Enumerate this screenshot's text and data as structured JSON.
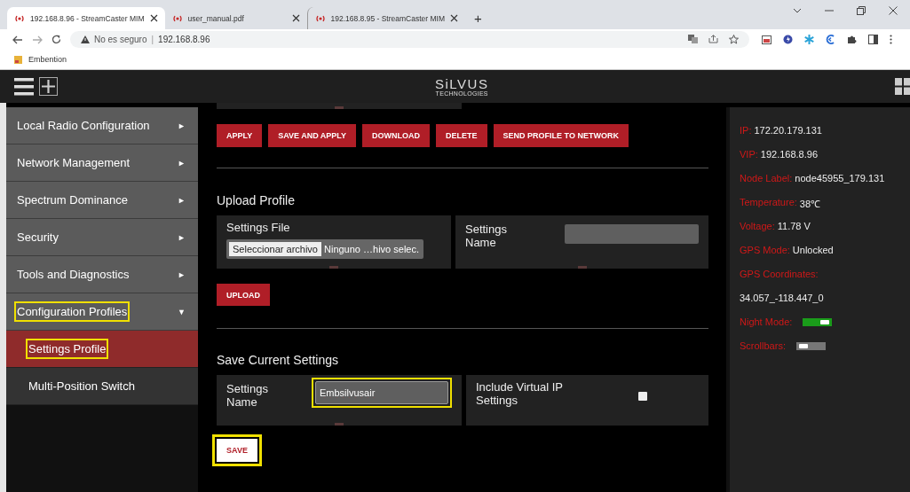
{
  "browser": {
    "tabs": [
      {
        "title": "192.168.8.96 - StreamCaster MIM",
        "selected": true
      },
      {
        "title": "user_manual.pdf",
        "selected": false
      },
      {
        "title": "192.168.8.95 - StreamCaster MIM",
        "selected": false
      }
    ],
    "new_tab": "+",
    "address": {
      "security": "No es seguro",
      "separator": "|",
      "url": "192.168.8.96"
    },
    "bookmarks": [
      "Embention"
    ]
  },
  "header": {
    "logo": "SiLVUS",
    "logo_sub": "TECHNOLOGIES"
  },
  "sidebar": {
    "items": [
      {
        "label": "Local Radio Configuration",
        "arrow": "►",
        "expanded": false,
        "highlighted": false
      },
      {
        "label": "Network Management",
        "arrow": "►",
        "expanded": false,
        "highlighted": false
      },
      {
        "label": "Spectrum Dominance",
        "arrow": "►",
        "expanded": false,
        "highlighted": false
      },
      {
        "label": "Security",
        "arrow": "►",
        "expanded": false,
        "highlighted": false
      },
      {
        "label": "Tools and Diagnostics",
        "arrow": "►",
        "expanded": false,
        "highlighted": false
      },
      {
        "label": "Configuration Profiles",
        "arrow": "▼",
        "expanded": true,
        "highlighted": true,
        "children": [
          {
            "label": "Settings Profile",
            "selected": true,
            "highlighted": true
          },
          {
            "label": "Multi-Position Switch",
            "selected": false,
            "highlighted": false
          }
        ]
      }
    ]
  },
  "main": {
    "actions": [
      "APPLY",
      "SAVE AND APPLY",
      "DOWNLOAD",
      "DELETE",
      "SEND PROFILE TO NETWORK"
    ],
    "upload": {
      "title": "Upload Profile",
      "file_label": "Settings File",
      "file_button": "Seleccionar archivo",
      "file_status": "Ninguno …hivo selec.",
      "name_label": "Settings Name",
      "button": "UPLOAD"
    },
    "save": {
      "title": "Save Current Settings",
      "name_label": "Settings Name",
      "name_value": "Embsilvusair",
      "name_highlighted": true,
      "vip_label": "Include Virtual IP Settings",
      "vip_checked": false,
      "button": "SAVE",
      "button_highlighted": true
    }
  },
  "status": [
    {
      "kind": "field",
      "label": "IP:",
      "value": "172.20.179.131"
    },
    {
      "kind": "field",
      "label": "VIP:",
      "value": "192.168.8.96"
    },
    {
      "kind": "field",
      "label": "Node Label:",
      "value": "node45955_179.131"
    },
    {
      "kind": "field",
      "label": "Temperature:",
      "value": "38℃"
    },
    {
      "kind": "field",
      "label": "Voltage:",
      "value": "11.78 V"
    },
    {
      "kind": "field",
      "label": "GPS Mode:",
      "value": "Unlocked"
    },
    {
      "kind": "field",
      "label": "GPS Coordinates:"
    },
    {
      "kind": "line",
      "value": "34.057_-118.447_0"
    },
    {
      "kind": "toggle",
      "label": "Night Mode:",
      "on": true
    },
    {
      "kind": "toggle",
      "label": "Scrollbars:",
      "on": false
    }
  ]
}
